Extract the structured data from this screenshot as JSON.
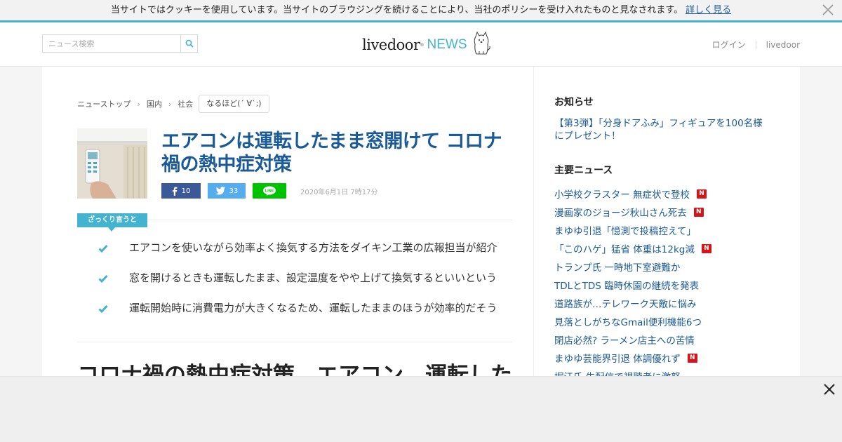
{
  "cookie": {
    "message": "当サイトではクッキーを使用しています。当サイトのブラウジングを続けることにより、当社のポリシーを受け入れたものと見なされます。",
    "more": "詳しく見る"
  },
  "header": {
    "search_placeholder": "ニュース検索",
    "logo_main": "livedoor",
    "logo_news": "NEWS",
    "login": "ログイン",
    "livedoor": "livedoor"
  },
  "breadcrumb": [
    "ニューストップ",
    "国内",
    "社会"
  ],
  "tag": "なるほど(´ ∀`;)",
  "article": {
    "title": "エアコンは運転したまま窓開けて コロナ禍の熱中症対策",
    "facebook_count": "10",
    "twitter_count": "33",
    "line_label": "LINE",
    "date": "2020年6月1日 7時17分",
    "summary_label": "ざっくり言うと",
    "points": [
      "エアコンを使いながら効率よく換気する方法をダイキン工業の広報担当が紹介",
      "窓を開けるときも運転したまま、設定温度をやや上げて換気するといいという",
      "運転開始時に消費電力が大きくなるため、運転したままのほうが効率的だそう"
    ],
    "headline": "コロナ禍の熱中症対策　エアコン　運転した"
  },
  "sidebar": {
    "notice_heading": "お知らせ",
    "notice_link": "【第3弾】「分身ドアふみ」フィギュアを100名様にプレゼント！",
    "news_heading": "主要ニュース",
    "news": [
      {
        "text": "小学校クラスター 無症状で登校",
        "badge": "N"
      },
      {
        "text": "漫画家のジョージ秋山さん死去",
        "badge": "N"
      },
      {
        "text": "まゆゆ引退「憶測で投稿控えて」",
        "badge": ""
      },
      {
        "text": "「このハゲ」猛省 体重は12kg減",
        "badge": "N"
      },
      {
        "text": "トランプ氏 一時地下室避難か",
        "badge": ""
      },
      {
        "text": "TDLとTDS 臨時休園の継続を発表",
        "badge": ""
      },
      {
        "text": "道路族が…テレワーク天敵に悩み",
        "badge": ""
      },
      {
        "text": "見落としがちなGmail便利機能6つ",
        "badge": ""
      },
      {
        "text": "閉店必然? ラーメン店主への苦情",
        "badge": ""
      },
      {
        "text": "まゆゆ芸能界引退 体調優れず",
        "badge": "N"
      },
      {
        "text": "堀江氏 生配信で視聴者に激怒",
        "badge": ""
      }
    ]
  },
  "colors": {
    "accent": "#44b3cf",
    "link": "#1a5a96",
    "facebook": "#3b5998",
    "twitter": "#55acee",
    "line": "#00c300",
    "new_badge": "#d7141a"
  }
}
